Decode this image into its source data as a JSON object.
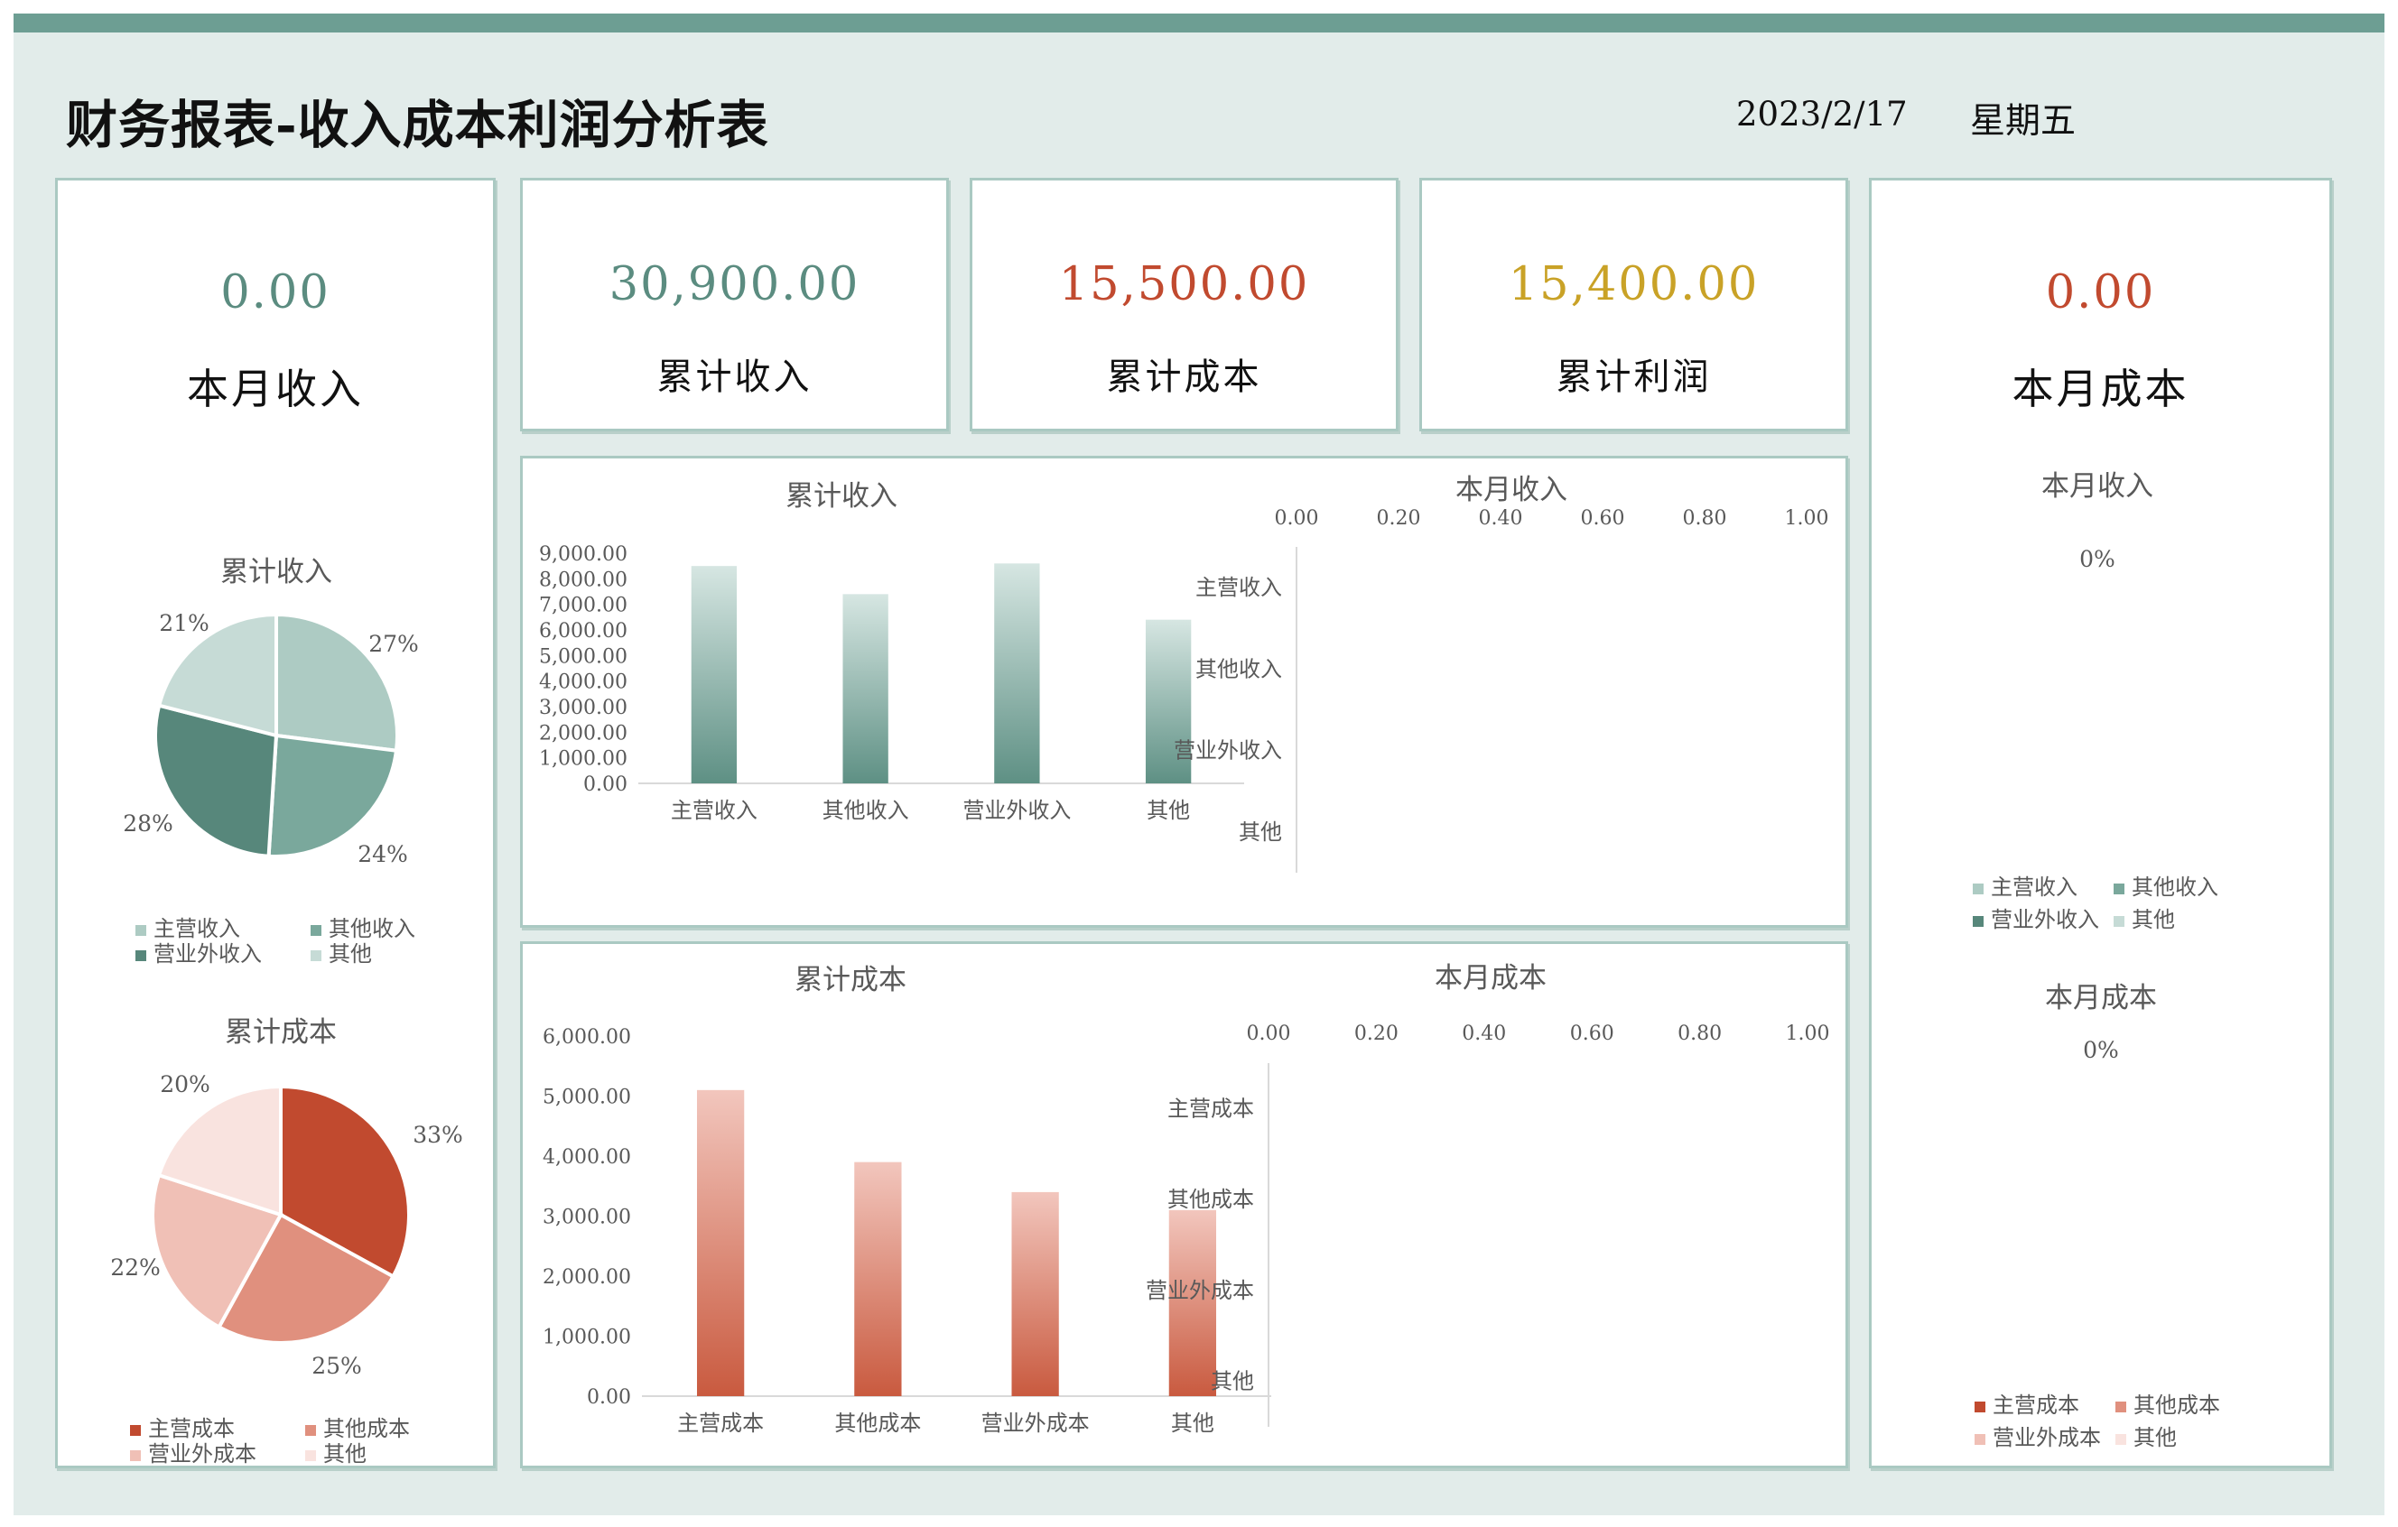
{
  "header": {
    "title": "财务报表-收入成本利润分析表",
    "date": "2023/2/17",
    "weekday": "星期五"
  },
  "colors": {
    "frame_bg": "#e2ecea",
    "top_bar": "#6d9e93",
    "card_border": "#aac9c2",
    "income_green": "#5b8c80",
    "cost_red": "#c14a2f",
    "profit_gold": "#c9a227"
  },
  "kpis": {
    "monthly_income": {
      "value": "0.00",
      "label": "本月收入",
      "color": "#5b8c80"
    },
    "cumulative_income": {
      "value": "30,900.00",
      "label": "累计收入",
      "color": "#5b8c80"
    },
    "cumulative_cost": {
      "value": "15,500.00",
      "label": "累计成本",
      "color": "#c14a2f"
    },
    "cumulative_profit": {
      "value": "15,400.00",
      "label": "累计利润",
      "color": "#c9a227"
    },
    "monthly_cost": {
      "value": "0.00",
      "label": "本月成本",
      "color": "#c14a2f"
    }
  },
  "chart_data": [
    {
      "id": "pie_income",
      "type": "pie",
      "title": "累计收入",
      "categories": [
        "主营收入",
        "其他收入",
        "营业外收入",
        "其他"
      ],
      "values": [
        27,
        24,
        28,
        21
      ],
      "labels": [
        "27%",
        "24%",
        "28%",
        "21%"
      ],
      "colors": [
        "#adcbc3",
        "#7aa89c",
        "#57877b",
        "#c6dbd6"
      ],
      "legend_position": "bottom"
    },
    {
      "id": "pie_cost",
      "type": "pie",
      "title": "累计成本",
      "categories": [
        "主营成本",
        "其他成本",
        "营业外成本",
        "其他"
      ],
      "values": [
        33,
        25,
        22,
        20
      ],
      "labels": [
        "33%",
        "25%",
        "22%",
        "20%"
      ],
      "colors": [
        "#c14a2f",
        "#e0907e",
        "#f0c0b6",
        "#f9e3df"
      ],
      "legend_position": "bottom"
    },
    {
      "id": "bar_income",
      "type": "bar",
      "title": "累计收入",
      "categories": [
        "主营收入",
        "其他收入",
        "营业外收入",
        "其他"
      ],
      "values": [
        8500,
        7400,
        8600,
        6400
      ],
      "yticks": [
        "0.00",
        "1,000.00",
        "2,000.00",
        "3,000.00",
        "4,000.00",
        "5,000.00",
        "6,000.00",
        "7,000.00",
        "8,000.00",
        "9,000.00"
      ],
      "ylim": [
        0,
        9000
      ],
      "grid": false,
      "color_top": "#d6e6e2",
      "color_bottom": "#5e9084"
    },
    {
      "id": "hbar_income_month",
      "type": "bar",
      "orientation": "horizontal",
      "title": "本月收入",
      "categories": [
        "主营收入",
        "其他收入",
        "营业外收入",
        "其他"
      ],
      "values": [
        0,
        0,
        0,
        0
      ],
      "xticks": [
        "0.00",
        "0.20",
        "0.40",
        "0.60",
        "0.80",
        "1.00"
      ],
      "xlim": [
        0,
        1
      ],
      "grid": false
    },
    {
      "id": "bar_cost",
      "type": "bar",
      "title": "累计成本",
      "categories": [
        "主营成本",
        "其他成本",
        "营业外成本",
        "其他"
      ],
      "values": [
        5100,
        3900,
        3400,
        3100
      ],
      "yticks": [
        "0.00",
        "1,000.00",
        "2,000.00",
        "3,000.00",
        "4,000.00",
        "5,000.00",
        "6,000.00"
      ],
      "ylim": [
        0,
        6000
      ],
      "grid": false,
      "color_top": "#f2c6bd",
      "color_bottom": "#c95a3f"
    },
    {
      "id": "hbar_cost_month",
      "type": "bar",
      "orientation": "horizontal",
      "title": "本月成本",
      "categories": [
        "主营成本",
        "其他成本",
        "营业外成本",
        "其他"
      ],
      "values": [
        0,
        0,
        0,
        0
      ],
      "xticks": [
        "0.00",
        "0.20",
        "0.40",
        "0.60",
        "0.80",
        "1.00"
      ],
      "xlim": [
        0,
        1
      ],
      "grid": false
    },
    {
      "id": "pie_income_month",
      "type": "pie",
      "title": "本月收入",
      "categories": [
        "主营收入",
        "其他收入",
        "营业外收入",
        "其他"
      ],
      "values": [
        0,
        0,
        0,
        0
      ],
      "labels": [
        "0%"
      ],
      "colors": [
        "#adcbc3",
        "#7aa89c",
        "#57877b",
        "#c6dbd6"
      ],
      "legend_position": "bottom"
    },
    {
      "id": "pie_cost_month",
      "type": "pie",
      "title": "本月成本",
      "categories": [
        "主营成本",
        "其他成本",
        "营业外成本",
        "其他"
      ],
      "values": [
        0,
        0,
        0,
        0
      ],
      "labels": [
        "0%"
      ],
      "colors": [
        "#c14a2f",
        "#e0907e",
        "#f0c0b6",
        "#f9e3df"
      ],
      "legend_position": "bottom"
    }
  ]
}
